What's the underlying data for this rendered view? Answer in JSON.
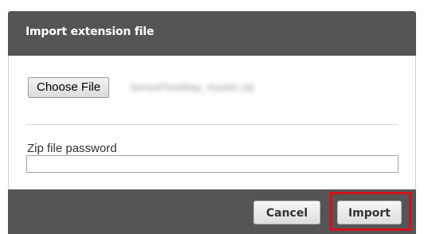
{
  "dialog": {
    "title": "Import extension file",
    "choose_file_label": "Choose File",
    "selected_file_name": "SenseFlowMap_master.zip",
    "password_label": "Zip file password",
    "password_value": "",
    "cancel_label": "Cancel",
    "import_label": "Import",
    "highlight_color": "#d4111c"
  }
}
